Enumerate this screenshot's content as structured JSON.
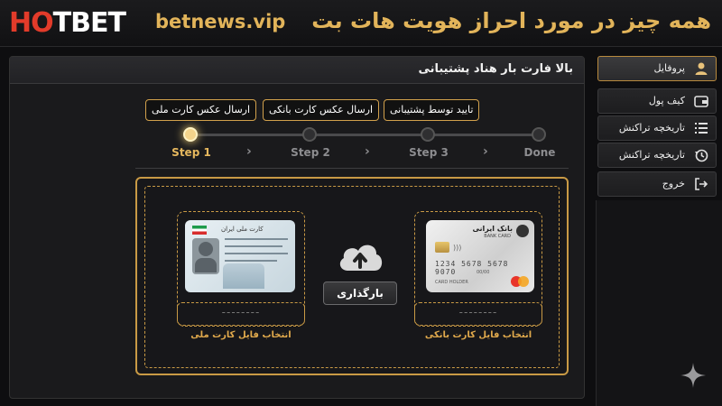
{
  "header": {
    "logo_ho": "HO",
    "logo_t": "T",
    "logo_bet": "BET",
    "site": "betnews.vip",
    "headline": "همه چیز در مورد احراز هویت هات بت"
  },
  "panel": {
    "title": "بالا فارت بار هناد پشتیبانی"
  },
  "steps": [
    {
      "label": "Step 1",
      "tip": "ارسال عکس کارت ملی",
      "active": true
    },
    {
      "label": "Step 2",
      "tip": "ارسال عکس کارت بانکی",
      "active": false
    },
    {
      "label": "Step 3",
      "tip": "تایید توسط پشتیبانی",
      "active": false
    },
    {
      "label": "Done",
      "tip": "",
      "active": false
    }
  ],
  "chevron": "›",
  "upload": {
    "button": "بارگذاری",
    "id_card_caption": "انتخاب فایل کارت ملی",
    "bank_card_caption": "انتخاب فایل کارت بانکی",
    "placeholder": "--------"
  },
  "id_card": {
    "title": "کارت ملی ایران"
  },
  "bank_card": {
    "bank_name": "بانک ایرانی",
    "sub": "BANK CARD",
    "number": "1234 5678 5678 9070",
    "expiry": "00/00",
    "holder": "CARD HOLDER"
  },
  "sidebar": {
    "items": [
      {
        "label": "پروفایل",
        "icon": "user-icon",
        "active": true
      },
      {
        "label": "کیف پول",
        "icon": "wallet-icon",
        "active": false
      },
      {
        "label": "تاریخچه تراکنش",
        "icon": "list-icon",
        "active": false
      },
      {
        "label": "تاریخچه تراکنش",
        "icon": "history-icon",
        "active": false
      },
      {
        "label": "خروج",
        "icon": "logout-icon",
        "active": false
      }
    ]
  },
  "colors": {
    "accent": "#e2b45a",
    "border": "#c99a45",
    "logo_red": "#e23b2a"
  }
}
